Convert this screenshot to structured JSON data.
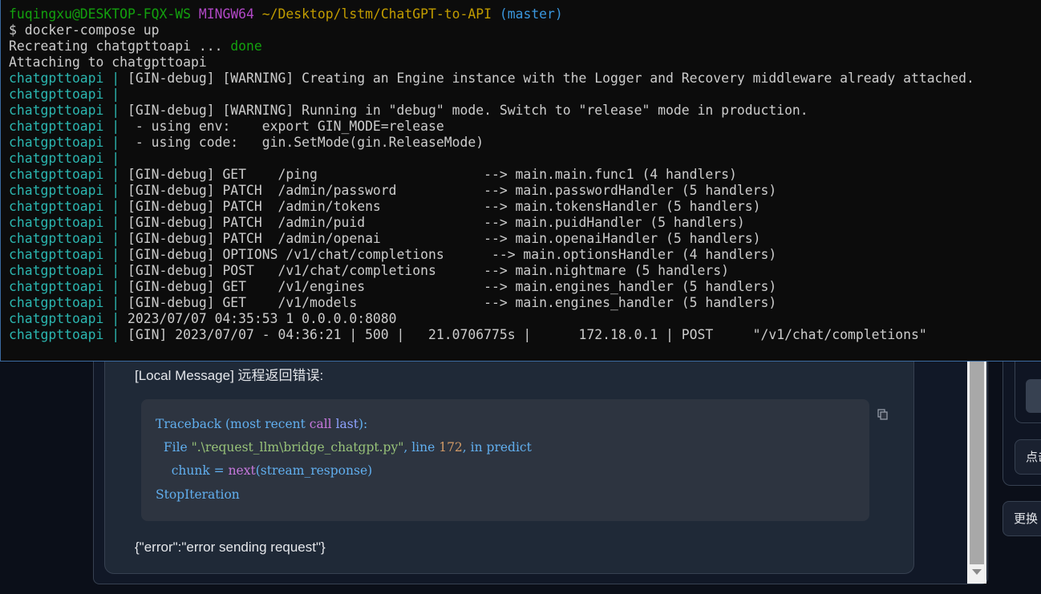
{
  "terminal": {
    "prompt": {
      "user_host": "fuqingxu@DESKTOP-FQX-WS",
      "shell": "MINGW64",
      "path": "~/Desktop/lstm/ChatGPT-to-API",
      "branch": "(master)"
    },
    "command": "$ docker-compose up",
    "recreating": "Recreating chatgpttoapi ... ",
    "done": "done",
    "attaching": "Attaching to chatgpttoapi",
    "service_prefix": "chatgpttoapi |",
    "log_lines": [
      " [GIN-debug] [WARNING] Creating an Engine instance with the Logger and Recovery middleware already attached.",
      "",
      " [GIN-debug] [WARNING] Running in \"debug\" mode. Switch to \"release\" mode in production.",
      "  - using env:    export GIN_MODE=release",
      "  - using code:   gin.SetMode(gin.ReleaseMode)",
      "",
      " [GIN-debug] GET    /ping                     --> main.main.func1 (4 handlers)",
      " [GIN-debug] PATCH  /admin/password           --> main.passwordHandler (5 handlers)",
      " [GIN-debug] PATCH  /admin/tokens             --> main.tokensHandler (5 handlers)",
      " [GIN-debug] PATCH  /admin/puid               --> main.puidHandler (5 handlers)",
      " [GIN-debug] PATCH  /admin/openai             --> main.openaiHandler (5 handlers)",
      " [GIN-debug] OPTIONS /v1/chat/completions      --> main.optionsHandler (4 handlers)",
      " [GIN-debug] POST   /v1/chat/completions      --> main.nightmare (5 handlers)",
      " [GIN-debug] GET    /v1/engines               --> main.engines_handler (5 handlers)",
      " [GIN-debug] GET    /v1/models                --> main.engines_handler (5 handlers)",
      " 2023/07/07 04:35:53 1 0.0.0.0:8080",
      " [GIN] 2023/07/07 - 04:36:21 | 500 |   21.0706775s |      172.18.0.1 | POST     \"/v1/chat/completions\""
    ]
  },
  "chat": {
    "local_message": "[Local Message] 远程返回错误:",
    "traceback": {
      "line1_a": "Traceback (most recent ",
      "line1_kw": "call",
      "line1_b": " ",
      "line1_hl": "last",
      "line1_c": "):",
      "line2_a": "  File ",
      "line2_str": "\".\\request_llm\\bridge_chatgpt.py\"",
      "line2_b": ", line ",
      "line2_num": "172",
      "line2_c": ", in predict",
      "line3_a": "    chunk = ",
      "line3_kw": "next",
      "line3_b": "(stream_response)",
      "line4": "StopIteration"
    },
    "error_text": "{\"error\":\"error sending request\"}"
  },
  "right_panel": {
    "button1_label": "点击",
    "button2_label": "更换"
  },
  "colors": {
    "terminal_bg": "#0c0c0c",
    "prompt_green": "#13a10e",
    "service_cyan": "#2bb6b0",
    "app_bg": "#0b0f19",
    "code_bg": "#2d3440"
  }
}
